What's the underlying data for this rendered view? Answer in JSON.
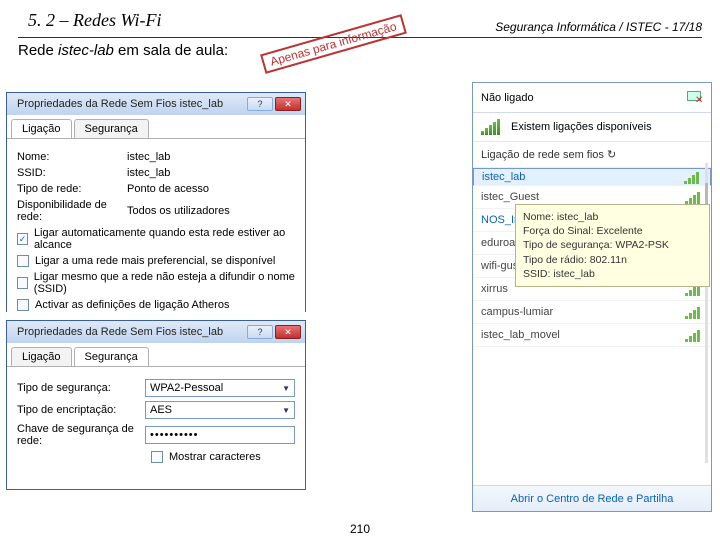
{
  "header": {
    "title": "5. 2 – Redes Wi-Fi",
    "right": "Segurança Informática / ISTEC - 17/18",
    "sub_prefix": "Rede ",
    "sub_italic": "istec-lab",
    "sub_suffix": " em sala de aula:",
    "stamp": "Apenas para informação"
  },
  "dlg1": {
    "title": "Propriedades da Rede Sem Fios istec_lab",
    "tab1": "Ligação",
    "tab2": "Segurança",
    "rows": {
      "name_lbl": "Nome:",
      "name_val": "istec_lab",
      "ssid_lbl": "SSID:",
      "ssid_val": "istec_lab",
      "type_lbl": "Tipo de rede:",
      "type_val": "Ponto de acesso",
      "avail_lbl": "Disponibilidade de rede:",
      "avail_val": "Todos os utilizadores"
    },
    "chk1": "Ligar automaticamente quando esta rede estiver ao alcance",
    "chk2": "Ligar a uma rede mais preferencial, se disponível",
    "chk3": "Ligar mesmo que a rede não esteja a difundir o nome (SSID)",
    "chk4": "Activar as definições de ligação Atheros"
  },
  "dlg2": {
    "title": "Propriedades da Rede Sem Fios istec_lab",
    "tab1": "Ligação",
    "tab2": "Segurança",
    "sec_type_lbl": "Tipo de segurança:",
    "sec_type_val": "WPA2-Pessoal",
    "enc_type_lbl": "Tipo de encriptação:",
    "enc_type_val": "AES",
    "key_lbl": "Chave de segurança de rede:",
    "key_val": "••••••••••",
    "show_lbl": "Mostrar caracteres"
  },
  "flyout": {
    "not_connected": "Não ligado",
    "available": "Existem ligações disponíveis",
    "section": "Ligação de rede sem fios",
    "networks": [
      "istec_lab",
      "istec_Guest",
      "NOS_Internet_Movel",
      "eduroam",
      "wifi-gustaveeiffel",
      "xirrus",
      "campus-lumiar",
      "istec_lab_movel"
    ],
    "footer": "Abrir o Centro de Rede e Partilha"
  },
  "tooltip": {
    "l1": "Nome: istec_lab",
    "l2": "Força do Sinal: Excelente",
    "l3": "Tipo de segurança: WPA2-PSK",
    "l4": "Tipo de rádio: 802.11n",
    "l5": "SSID: istec_lab"
  },
  "page": "210"
}
